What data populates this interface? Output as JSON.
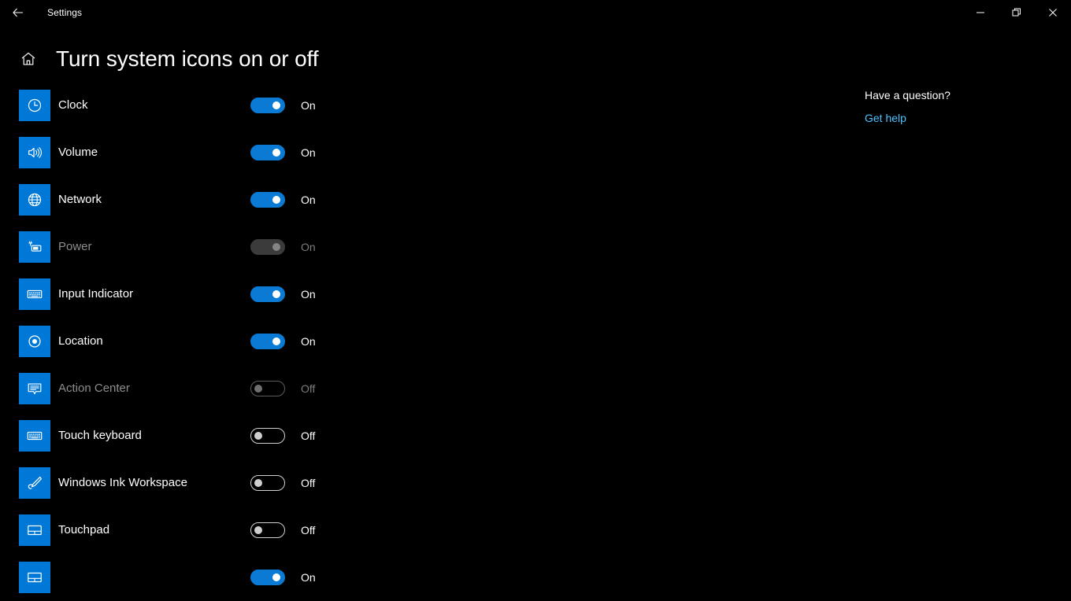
{
  "window": {
    "app_title": "Settings",
    "back_icon": "back-arrow-icon",
    "minimize_label": "—",
    "restore_label": "❐",
    "close_label": "✕"
  },
  "header": {
    "home_icon": "home-icon",
    "title": "Turn system icons on or off"
  },
  "settings": {
    "rows": [
      {
        "label": "Clock",
        "icon": "clock-icon",
        "state": "On",
        "on": true,
        "disabled": false
      },
      {
        "label": "Volume",
        "icon": "volume-icon",
        "state": "On",
        "on": true,
        "disabled": false
      },
      {
        "label": "Network",
        "icon": "network-icon",
        "state": "On",
        "on": true,
        "disabled": false
      },
      {
        "label": "Power",
        "icon": "power-icon",
        "state": "On",
        "on": true,
        "disabled": true
      },
      {
        "label": "Input Indicator",
        "icon": "keyboard-icon",
        "state": "On",
        "on": true,
        "disabled": false
      },
      {
        "label": "Location",
        "icon": "location-icon",
        "state": "On",
        "on": true,
        "disabled": false
      },
      {
        "label": "Action Center",
        "icon": "action-center-icon",
        "state": "Off",
        "on": false,
        "disabled": true
      },
      {
        "label": "Touch keyboard",
        "icon": "keyboard-icon",
        "state": "Off",
        "on": false,
        "disabled": false
      },
      {
        "label": "Windows Ink Workspace",
        "icon": "pen-icon",
        "state": "Off",
        "on": false,
        "disabled": false
      },
      {
        "label": "Touchpad",
        "icon": "touchpad-icon",
        "state": "Off",
        "on": false,
        "disabled": false
      },
      {
        "label": "",
        "icon": "touchpad-icon",
        "state": "On",
        "on": true,
        "disabled": false
      }
    ]
  },
  "help": {
    "heading": "Have a question?",
    "link_label": "Get help"
  },
  "colors": {
    "background": "#000000",
    "accent": "#0078d7",
    "toggle_on": "#0a7ad5",
    "link": "#4cc2ff",
    "text": "#ffffff",
    "text_disabled": "#7d7d7d"
  }
}
